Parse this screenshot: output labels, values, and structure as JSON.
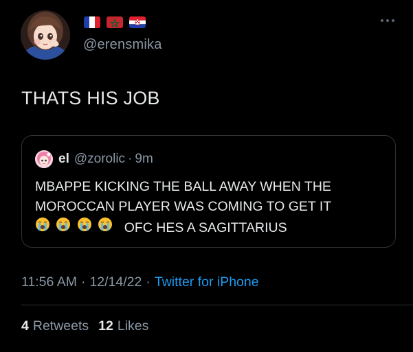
{
  "author": {
    "handle": "@erensmika",
    "flags": [
      "france-flag",
      "morocco-flag",
      "croatia-flag"
    ]
  },
  "tweet": {
    "text": "THATS HIS JOB"
  },
  "quoted": {
    "name": "el",
    "handle": "@zorolic",
    "dot": "·",
    "time": "9m",
    "line1": "MBAPPE KICKING THE BALL AWAY WHEN THE",
    "line2": "MOROCCAN PLAYER WAS COMING TO GET IT",
    "emojis": [
      "loudly-crying-face-icon",
      "loudly-crying-face-icon",
      "loudly-crying-face-icon",
      "loudly-crying-face-icon"
    ],
    "line3": "OFC HES A SAGITTARIUS"
  },
  "meta": {
    "time": "11:56 AM",
    "sep1": "·",
    "date": "12/14/22",
    "sep2": "·",
    "source": "Twitter for iPhone"
  },
  "stats": {
    "retweets_count": "4",
    "retweets_label": "Retweets",
    "likes_count": "12",
    "likes_label": "Likes"
  },
  "colors": {
    "background": "#000000",
    "text": "#e7e9ea",
    "secondary": "#8b98a5",
    "link": "#1d9bf0",
    "border": "#2f3336"
  }
}
